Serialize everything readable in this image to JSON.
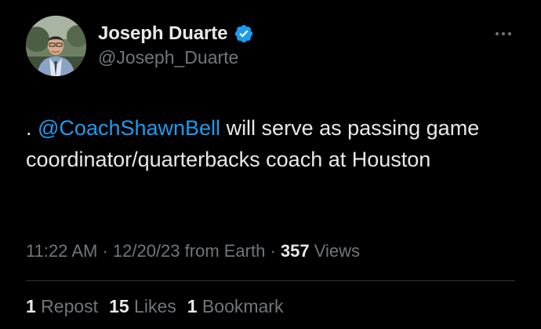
{
  "author": {
    "display_name": "Joseph Duarte",
    "handle": "@Joseph_Duarte",
    "verified": true,
    "verified_color": "#1d9bf0"
  },
  "tweet": {
    "prefix": ". ",
    "mention": "@CoachShawnBell",
    "text_after_mention": " will serve as passing game coordinator/quarterbacks coach at Houston"
  },
  "meta": {
    "time": "11:22 AM",
    "separator": " · ",
    "date": "12/20/23",
    "source": " from Earth",
    "views_count": "357",
    "views_label": " Views"
  },
  "stats": {
    "reposts_count": "1",
    "reposts_label": " Repost",
    "likes_count": "15",
    "likes_label": " Likes",
    "bookmarks_count": "1",
    "bookmarks_label": " Bookmark"
  },
  "icons": {
    "more": "more-options-icon",
    "verified": "verified-badge-icon"
  },
  "colors": {
    "background": "#000000",
    "text_primary": "#e7e9ea",
    "text_secondary": "#71767b",
    "accent": "#1d9bf0",
    "divider": "#2f3336"
  }
}
